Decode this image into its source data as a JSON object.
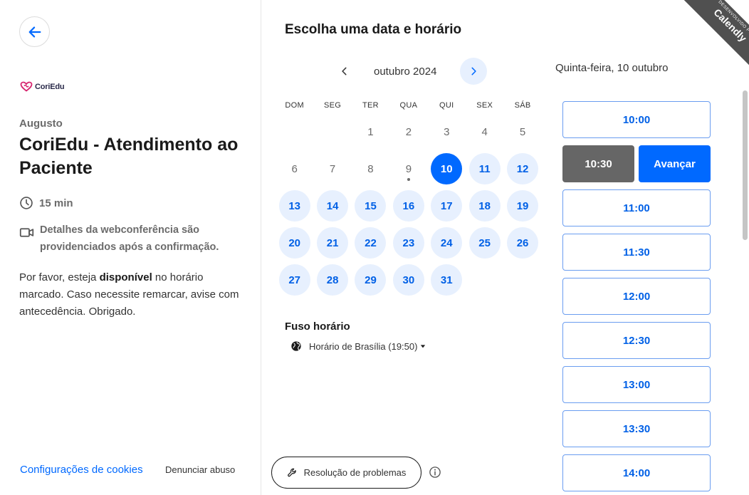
{
  "left": {
    "back_icon": "arrow-left-icon",
    "logo_text": "CoriEdu",
    "host_name": "Augusto",
    "event_title": "CoriEdu - Atendimento ao Paciente",
    "duration": "15 min",
    "conference_details": "Detalhes da webconferência são providenciados após a confirmação.",
    "description_part1": "Por favor, esteja ",
    "description_bold": "disponível",
    "description_part2": " no horário marcado. Caso necessite remarcar, avise com antecedência. Obrigado.",
    "cookie_settings": "Configurações de cookies",
    "report_abuse": "Denunciar abuso"
  },
  "calendar": {
    "heading": "Escolha uma data e horário",
    "month_label": "outubro 2024",
    "weekdays": [
      "DOM",
      "SEG",
      "TER",
      "QUA",
      "QUI",
      "SEX",
      "SÁB"
    ],
    "days": [
      {
        "n": "",
        "state": "empty"
      },
      {
        "n": "",
        "state": "empty"
      },
      {
        "n": "1",
        "state": "disabled"
      },
      {
        "n": "2",
        "state": "disabled"
      },
      {
        "n": "3",
        "state": "disabled"
      },
      {
        "n": "4",
        "state": "disabled"
      },
      {
        "n": "5",
        "state": "disabled"
      },
      {
        "n": "6",
        "state": "disabled"
      },
      {
        "n": "7",
        "state": "disabled"
      },
      {
        "n": "8",
        "state": "disabled"
      },
      {
        "n": "9",
        "state": "today"
      },
      {
        "n": "10",
        "state": "selected"
      },
      {
        "n": "11",
        "state": "available"
      },
      {
        "n": "12",
        "state": "available"
      },
      {
        "n": "13",
        "state": "available"
      },
      {
        "n": "14",
        "state": "available"
      },
      {
        "n": "15",
        "state": "available"
      },
      {
        "n": "16",
        "state": "available"
      },
      {
        "n": "17",
        "state": "available"
      },
      {
        "n": "18",
        "state": "available"
      },
      {
        "n": "19",
        "state": "available"
      },
      {
        "n": "20",
        "state": "available"
      },
      {
        "n": "21",
        "state": "available"
      },
      {
        "n": "22",
        "state": "available"
      },
      {
        "n": "23",
        "state": "available"
      },
      {
        "n": "24",
        "state": "available"
      },
      {
        "n": "25",
        "state": "available"
      },
      {
        "n": "26",
        "state": "available"
      },
      {
        "n": "27",
        "state": "available"
      },
      {
        "n": "28",
        "state": "available"
      },
      {
        "n": "29",
        "state": "available"
      },
      {
        "n": "30",
        "state": "available"
      },
      {
        "n": "31",
        "state": "available"
      }
    ],
    "timezone_label": "Fuso horário",
    "timezone_value": "Horário de Brasília (19:50)",
    "troubleshoot": "Resolução de problemas"
  },
  "times": {
    "date_label": "Quinta-feira, 10 outubro",
    "slot_1000": "10:00",
    "selected_slot": "10:30",
    "next_button": "Avançar",
    "slot_1100": "11:00",
    "slot_1130": "11:30",
    "slot_1200": "12:00",
    "slot_1230": "12:30",
    "slot_1300": "13:00",
    "slot_1330": "13:30",
    "slot_1400": "14:00"
  },
  "ribbon": {
    "small": "DESENVOLVIDO POR",
    "brand": "Calendly"
  },
  "colors": {
    "accent": "#0069ff",
    "available_bg": "#e7f0fe",
    "selected_slot_bg": "#666666",
    "ribbon_bg": "#505050"
  }
}
